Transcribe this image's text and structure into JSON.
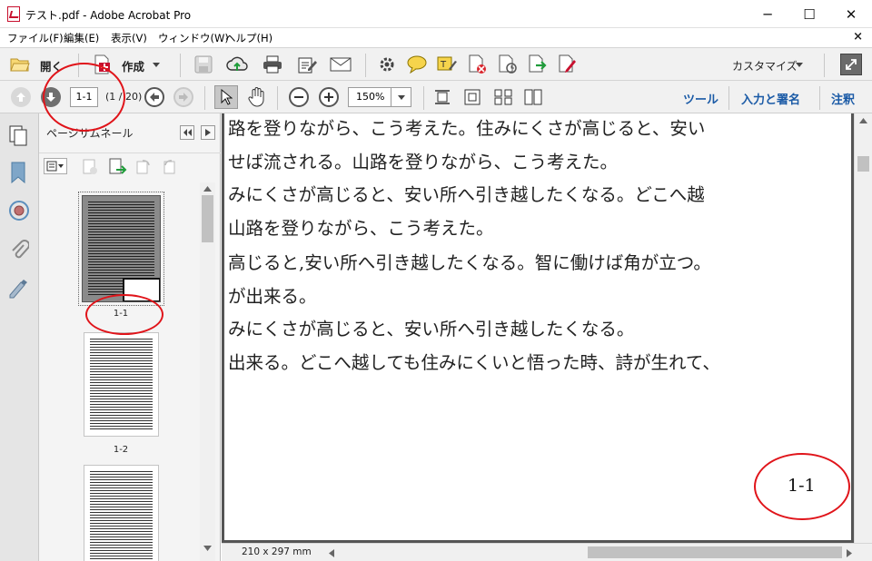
{
  "window": {
    "title": "テスト.pdf - Adobe Acrobat Pro",
    "minimize": "─",
    "maximize": "☐",
    "close": "✕"
  },
  "menu": {
    "items": [
      "ファイル(F)",
      "編集(E)",
      "表示(V)",
      "ウィンドウ(W)",
      "ヘルプ(H)"
    ],
    "close_doc": "×"
  },
  "toolbar": {
    "open_label": "開く",
    "create_label": "作成",
    "customize_label": "カスタマイズ"
  },
  "nav": {
    "page_value": "1-1",
    "page_count": "(1 / 20)",
    "zoom_value": "150%",
    "tools_label": "ツール",
    "sign_label": "入力と署名",
    "comment_label": "注釈"
  },
  "sidebar": {
    "title": "ページサムネール",
    "pages": [
      {
        "label": "1-1"
      },
      {
        "label": "1-2"
      },
      {
        "label": ""
      }
    ]
  },
  "document": {
    "lines": [
      "路を登りながら、こう考えた。住みにくさが高じると、安い",
      "せば流される。山路を登りながら、こう考えた。",
      "みにくさが高じると、安い所へ引き越したくなる。どこへ越",
      "山路を登りながら、こう考えた。",
      "高じると,安い所へ引き越したくなる。智に働けば角が立つ。",
      "が出来る。",
      "みにくさが高じると、安い所へ引き越したくなる。",
      "出来る。どこへ越しても住みにくいと悟った時、詩が生れて、"
    ],
    "page_number": "1-1"
  },
  "status": {
    "page_size": "210 x 297 mm"
  },
  "colors": {
    "accent_blue": "#1a5aa6",
    "annotation_red": "#e0141a",
    "acrobat_red": "#c8102e"
  },
  "icons": [
    "pdf-file-icon",
    "folder-open-icon",
    "create-pdf-icon",
    "save-icon",
    "cloud-upload-icon",
    "print-icon",
    "edit-icon",
    "mail-icon",
    "settings-icon",
    "comment-icon",
    "highlight-icon",
    "redact-icon",
    "send-icon",
    "export-icon",
    "fill-sign-icon",
    "expand-icon"
  ]
}
